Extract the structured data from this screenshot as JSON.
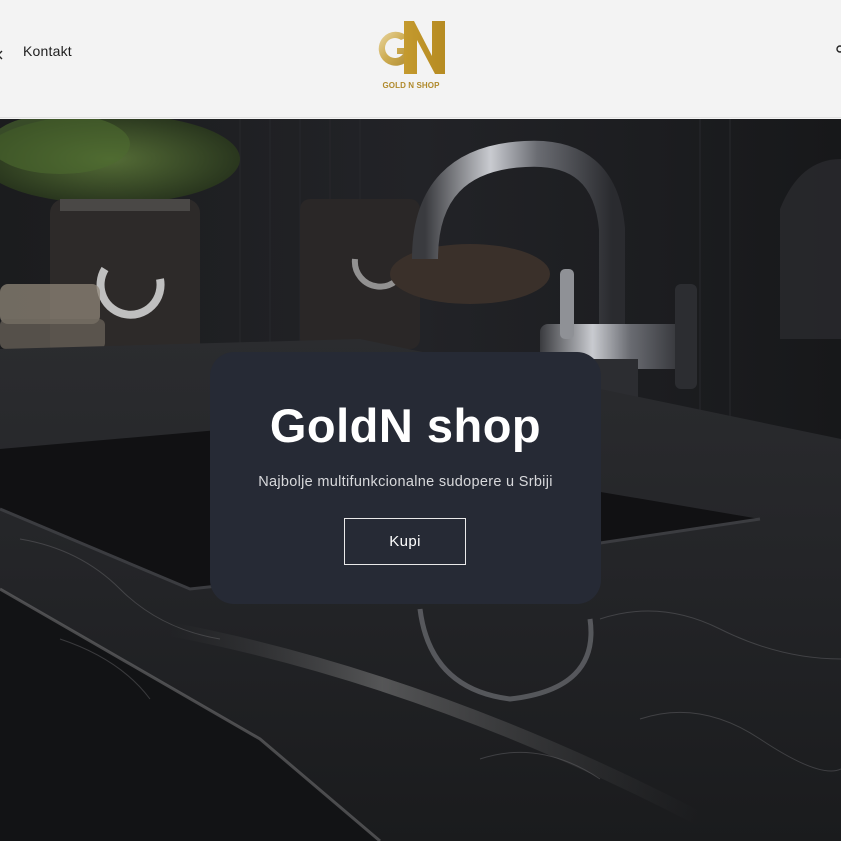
{
  "header": {
    "nav_link": "Kontakt",
    "logo_text": "GOLD N SHOP",
    "logo_letters": "GN",
    "icons": {
      "left_edge": "chevron-icon",
      "right_edge": "account-icon"
    }
  },
  "hero": {
    "title": "GoldN shop",
    "subtitle": "Najbolje multifunkcionalne sudopere u Srbiji",
    "button_label": "Kupi",
    "background_image": "dark marble kitchen sink with chrome faucet"
  },
  "colors": {
    "gold": "#c9a43f",
    "card": "#262a35",
    "header_bg": "#f3f3f3"
  }
}
